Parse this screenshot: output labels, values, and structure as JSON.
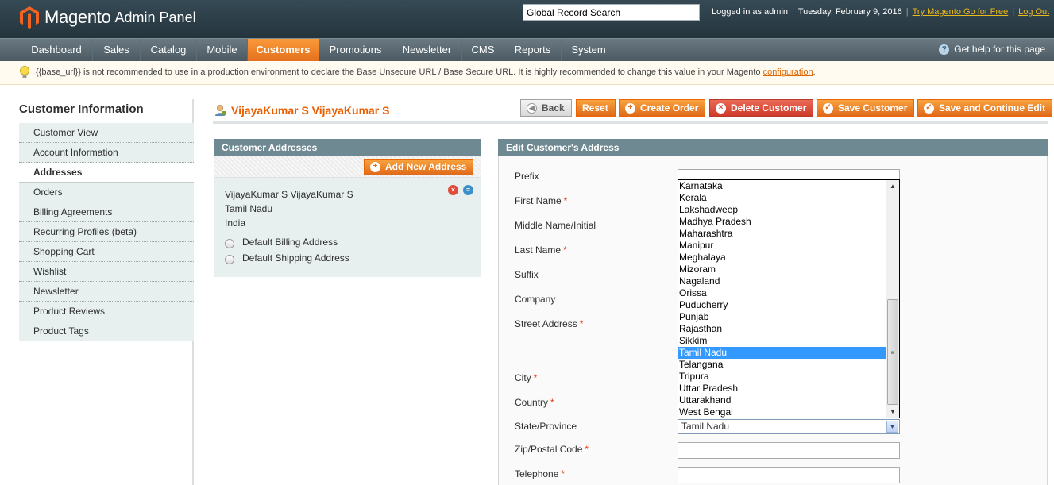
{
  "header": {
    "logo_text": "Magento",
    "logo_sub": "Admin Panel",
    "search_value": "Global Record Search",
    "logged_in": "Logged in as admin",
    "date": "Tuesday, February 9, 2016",
    "try_link": "Try Magento Go for Free",
    "logout": "Log Out"
  },
  "nav": {
    "items": [
      "Dashboard",
      "Sales",
      "Catalog",
      "Mobile",
      "Customers",
      "Promotions",
      "Newsletter",
      "CMS",
      "Reports",
      "System"
    ],
    "active": "Customers",
    "help": "Get help for this page"
  },
  "notice": {
    "text": "{{base_url}} is not recommended to use in a production environment to declare the Base Unsecure URL / Base Secure URL. It is highly recommended to change this value in your Magento",
    "link": "configuration",
    "end": "."
  },
  "sidebar": {
    "title": "Customer Information",
    "items": [
      "Customer View",
      "Account Information",
      "Addresses",
      "Orders",
      "Billing Agreements",
      "Recurring Profiles (beta)",
      "Shopping Cart",
      "Wishlist",
      "Newsletter",
      "Product Reviews",
      "Product Tags"
    ],
    "active": "Addresses"
  },
  "page": {
    "title": "VijayaKumar S VijayaKumar S",
    "buttons": {
      "back": "Back",
      "reset": "Reset",
      "create_order": "Create Order",
      "delete": "Delete Customer",
      "save": "Save Customer",
      "save_continue": "Save and Continue Edit"
    }
  },
  "addresses": {
    "header": "Customer Addresses",
    "add_button": "Add New Address",
    "name": "VijayaKumar S VijayaKumar S",
    "region": "Tamil Nadu",
    "country": "India",
    "default_billing": "Default Billing Address",
    "default_shipping": "Default Shipping Address"
  },
  "edit": {
    "header": "Edit Customer's Address",
    "labels": {
      "prefix": "Prefix",
      "first_name": "First Name",
      "middle_name": "Middle Name/Initial",
      "last_name": "Last Name",
      "suffix": "Suffix",
      "company": "Company",
      "street": "Street Address",
      "city": "City",
      "country": "Country",
      "state": "State/Province",
      "zip": "Zip/Postal Code",
      "telephone": "Telephone"
    },
    "required_mark": "*",
    "state_value": "Tamil Nadu",
    "state_options": [
      "Karnataka",
      "Kerala",
      "Lakshadweep",
      "Madhya Pradesh",
      "Maharashtra",
      "Manipur",
      "Meghalaya",
      "Mizoram",
      "Nagaland",
      "Orissa",
      "Puducherry",
      "Punjab",
      "Rajasthan",
      "Sikkim",
      "Tamil Nadu",
      "Telangana",
      "Tripura",
      "Uttar Pradesh",
      "Uttarakhand",
      "West Bengal"
    ],
    "selected_option": "Tamil Nadu"
  },
  "colors": {
    "accent": "#eb5e00",
    "nav_active": "#e4701e",
    "panel_header": "#6f8992"
  }
}
